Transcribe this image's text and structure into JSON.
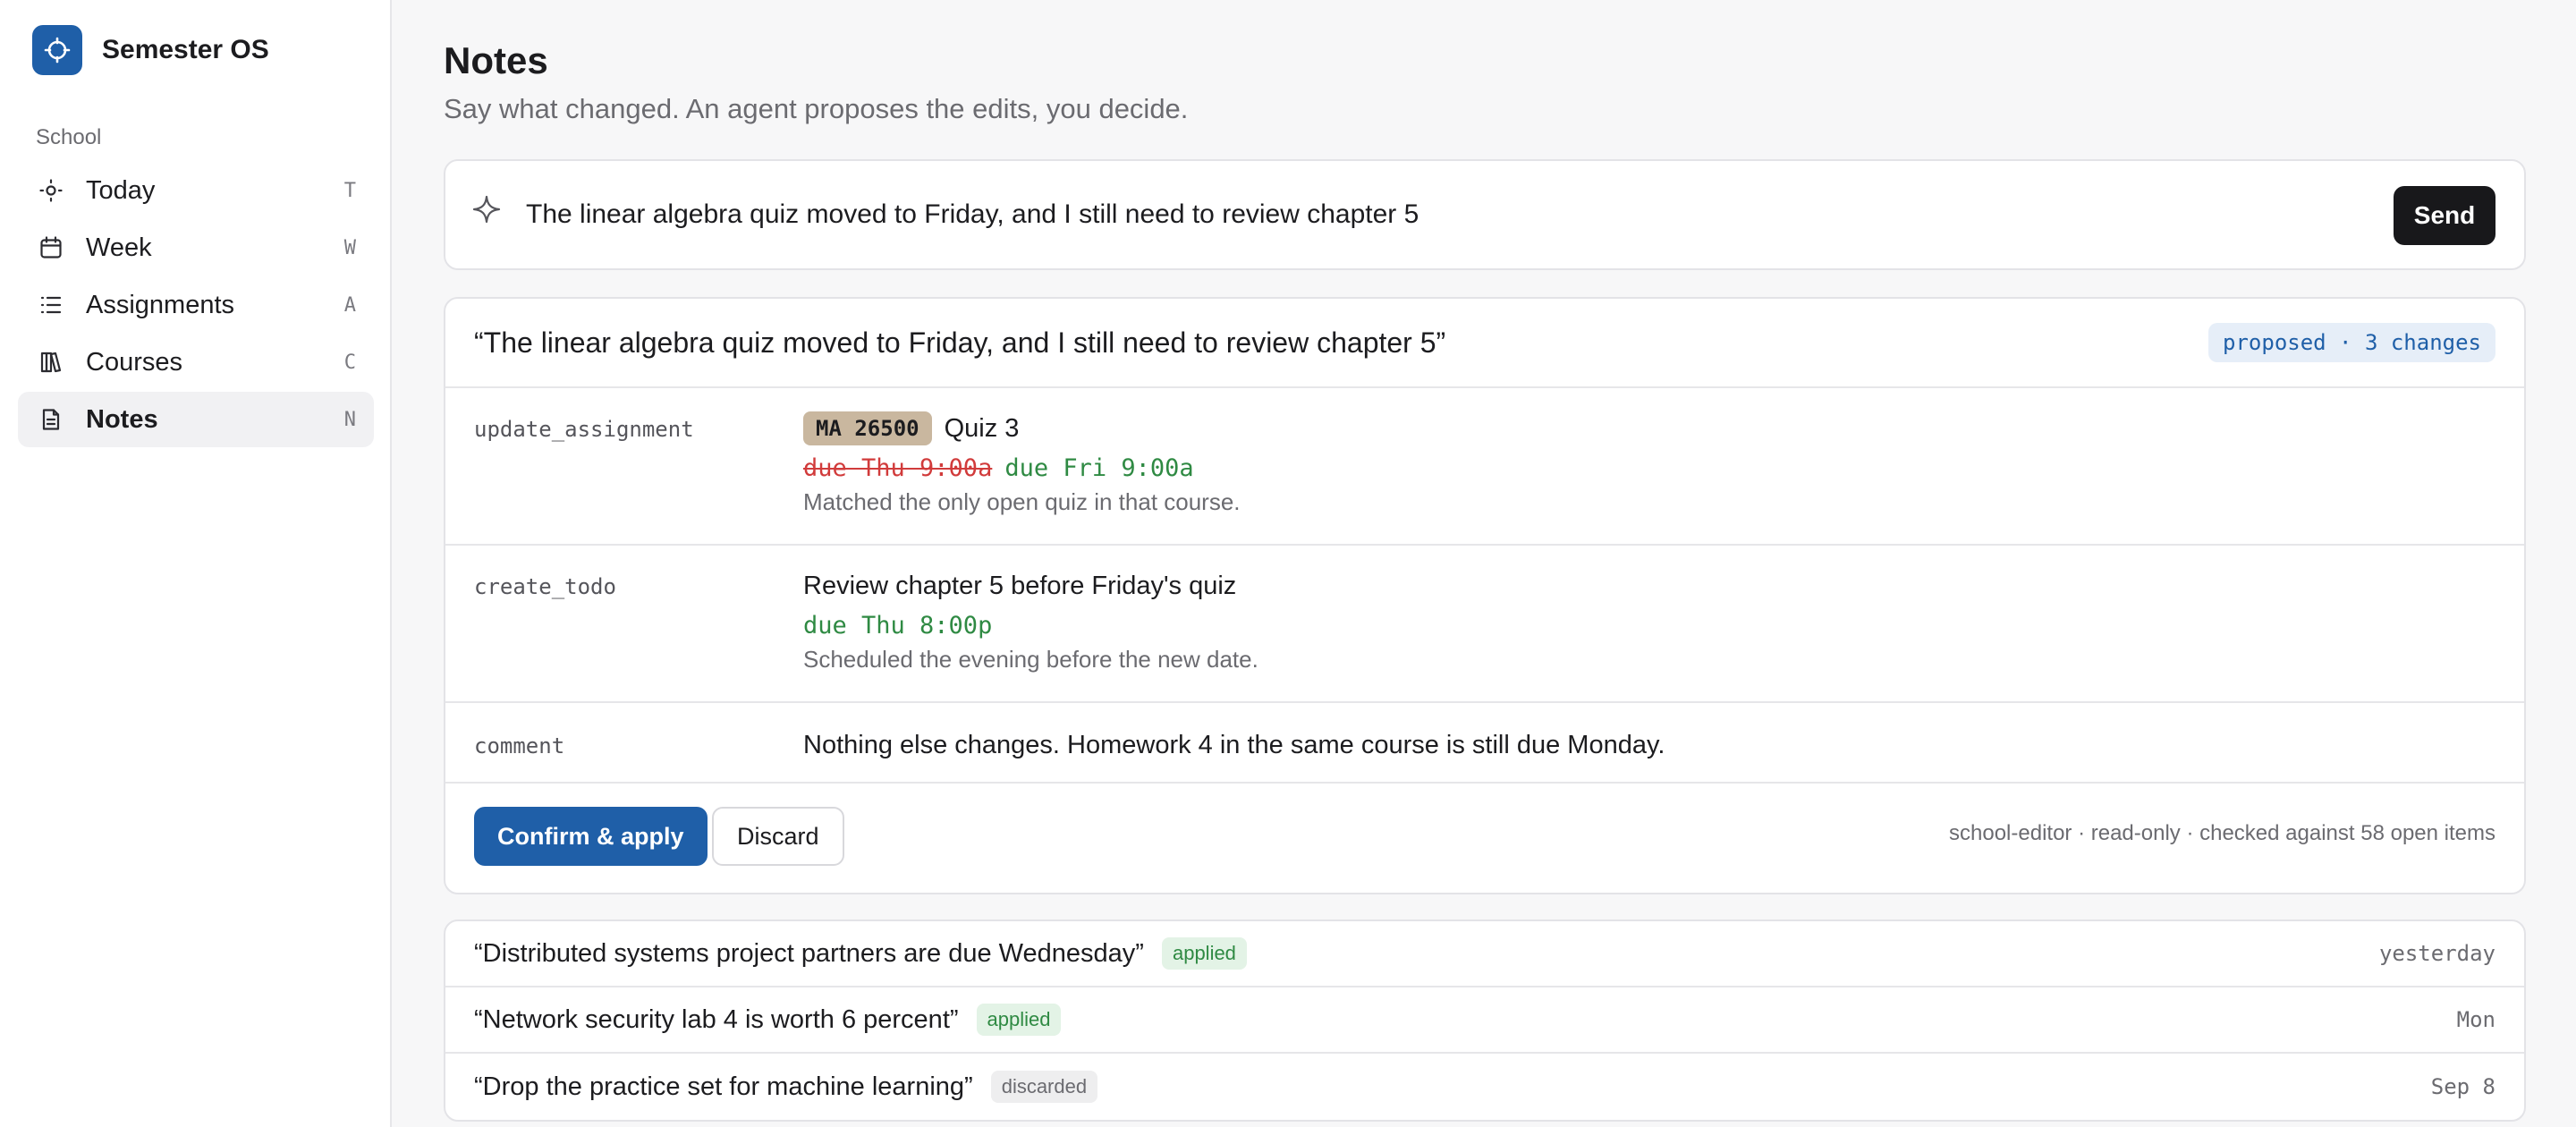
{
  "app": {
    "name": "Semester OS"
  },
  "colors": {
    "accent": "#1f5fa8",
    "send": "#18181b",
    "removed": "#d13b3b",
    "added": "#2f8a43"
  },
  "sidebar": {
    "section": "School",
    "items": [
      {
        "label": "Today",
        "key": "T",
        "icon": "sun-icon"
      },
      {
        "label": "Week",
        "key": "W",
        "icon": "calendar-icon"
      },
      {
        "label": "Assignments",
        "key": "A",
        "icon": "list-icon"
      },
      {
        "label": "Courses",
        "key": "C",
        "icon": "book-icon"
      },
      {
        "label": "Notes",
        "key": "N",
        "icon": "document-icon",
        "active": true
      }
    ]
  },
  "page": {
    "title": "Notes",
    "subtitle": "Say what changed. An agent proposes the edits, you decide."
  },
  "composer": {
    "value": "The linear algebra quiz moved to Friday, and I still need to review chapter 5",
    "send_label": "Send"
  },
  "proposal": {
    "quote": "“The linear algebra quiz moved to Friday, and I still need to review chapter 5”",
    "badge": "proposed · 3 changes",
    "changes": [
      {
        "type": "update_assignment",
        "course": "MA 26500",
        "title": "Quiz 3",
        "due_old": "due Thu 9:00a",
        "due_new": "due Fri 9:00a",
        "note": "Matched the only open quiz in that course."
      },
      {
        "type": "create_todo",
        "title": "Review chapter 5 before Friday's quiz",
        "due_new": "due Thu 8:00p",
        "note": "Scheduled the evening before the new date."
      },
      {
        "type": "comment",
        "title": "Nothing else changes. Homework 4 in the same course is still due Monday."
      }
    ],
    "confirm_label": "Confirm & apply",
    "discard_label": "Discard",
    "meta": "school-editor · read-only · checked against 58 open items"
  },
  "history": [
    {
      "quote": "“Distributed systems project partners are due Wednesday”",
      "status": "applied",
      "time": "yesterday"
    },
    {
      "quote": "“Network security lab 4 is worth 6 percent”",
      "status": "applied",
      "time": "Mon"
    },
    {
      "quote": "“Drop the practice set for machine learning”",
      "status": "discarded",
      "time": "Sep 8"
    }
  ]
}
